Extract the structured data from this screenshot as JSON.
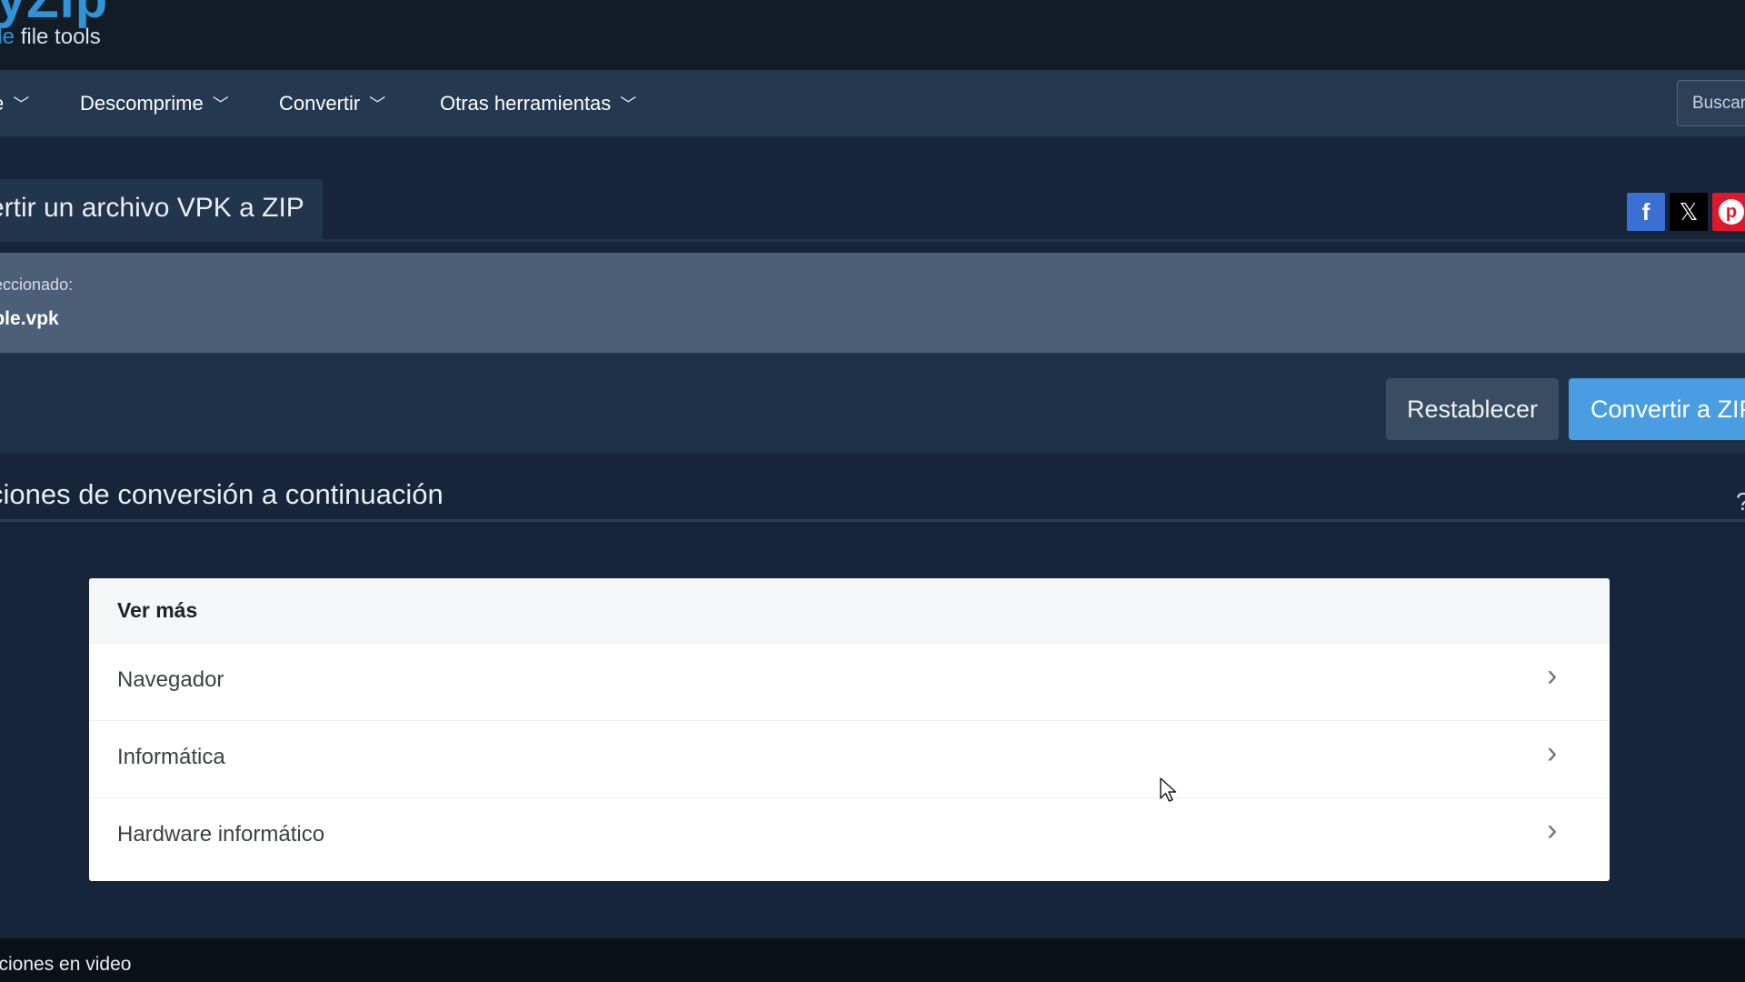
{
  "header": {
    "logo": "yZip",
    "tagline_accent": "ple",
    "tagline": " file tools"
  },
  "nav": {
    "items": [
      {
        "label": "e"
      },
      {
        "label": "Descomprime"
      },
      {
        "label": "Convertir"
      },
      {
        "label": "Otras herramientas"
      }
    ],
    "search_label": "Buscar"
  },
  "page": {
    "title": "ertir un archivo VPK a ZIP"
  },
  "social": {
    "facebook": "f",
    "x": "𝕏",
    "pinterest": "p"
  },
  "file": {
    "label": "seleccionado:",
    "name": "ample.vpk"
  },
  "actions": {
    "reset_label": "Restablecer",
    "convert_label": "Convertir a ZIP"
  },
  "options": {
    "heading": "ciones de conversión a continuación",
    "help": "?"
  },
  "card": {
    "title": "Ver más",
    "items": [
      {
        "label": "Navegador"
      },
      {
        "label": "Informática"
      },
      {
        "label": "Hardware informático"
      }
    ]
  },
  "footer": {
    "text": "cciones en video"
  },
  "colors": {
    "brand": "#2f93d6",
    "nav_bg": "#243850",
    "convert_button": "#4a9de0",
    "reset_button": "#3a4c62",
    "file_panel": "#4d5f77"
  }
}
